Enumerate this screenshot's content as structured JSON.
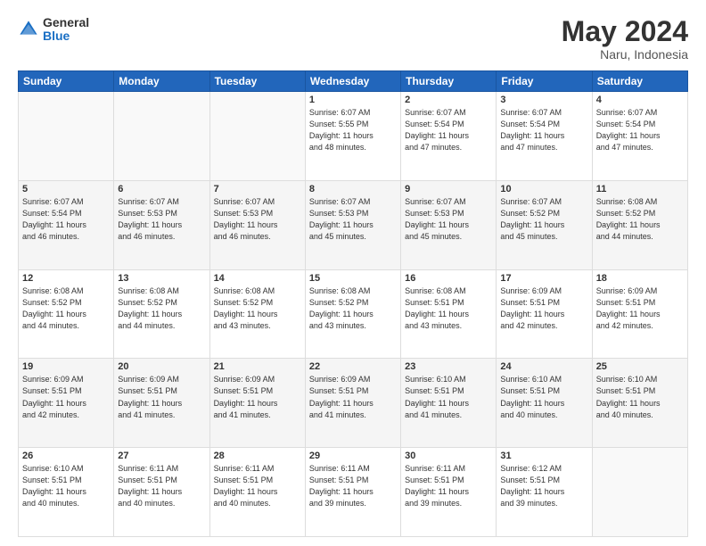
{
  "logo": {
    "general": "General",
    "blue": "Blue"
  },
  "title": "May 2024",
  "subtitle": "Naru, Indonesia",
  "days_header": [
    "Sunday",
    "Monday",
    "Tuesday",
    "Wednesday",
    "Thursday",
    "Friday",
    "Saturday"
  ],
  "weeks": [
    [
      {
        "num": "",
        "info": ""
      },
      {
        "num": "",
        "info": ""
      },
      {
        "num": "",
        "info": ""
      },
      {
        "num": "1",
        "info": "Sunrise: 6:07 AM\nSunset: 5:55 PM\nDaylight: 11 hours\nand 48 minutes."
      },
      {
        "num": "2",
        "info": "Sunrise: 6:07 AM\nSunset: 5:54 PM\nDaylight: 11 hours\nand 47 minutes."
      },
      {
        "num": "3",
        "info": "Sunrise: 6:07 AM\nSunset: 5:54 PM\nDaylight: 11 hours\nand 47 minutes."
      },
      {
        "num": "4",
        "info": "Sunrise: 6:07 AM\nSunset: 5:54 PM\nDaylight: 11 hours\nand 47 minutes."
      }
    ],
    [
      {
        "num": "5",
        "info": "Sunrise: 6:07 AM\nSunset: 5:54 PM\nDaylight: 11 hours\nand 46 minutes."
      },
      {
        "num": "6",
        "info": "Sunrise: 6:07 AM\nSunset: 5:53 PM\nDaylight: 11 hours\nand 46 minutes."
      },
      {
        "num": "7",
        "info": "Sunrise: 6:07 AM\nSunset: 5:53 PM\nDaylight: 11 hours\nand 46 minutes."
      },
      {
        "num": "8",
        "info": "Sunrise: 6:07 AM\nSunset: 5:53 PM\nDaylight: 11 hours\nand 45 minutes."
      },
      {
        "num": "9",
        "info": "Sunrise: 6:07 AM\nSunset: 5:53 PM\nDaylight: 11 hours\nand 45 minutes."
      },
      {
        "num": "10",
        "info": "Sunrise: 6:07 AM\nSunset: 5:52 PM\nDaylight: 11 hours\nand 45 minutes."
      },
      {
        "num": "11",
        "info": "Sunrise: 6:08 AM\nSunset: 5:52 PM\nDaylight: 11 hours\nand 44 minutes."
      }
    ],
    [
      {
        "num": "12",
        "info": "Sunrise: 6:08 AM\nSunset: 5:52 PM\nDaylight: 11 hours\nand 44 minutes."
      },
      {
        "num": "13",
        "info": "Sunrise: 6:08 AM\nSunset: 5:52 PM\nDaylight: 11 hours\nand 44 minutes."
      },
      {
        "num": "14",
        "info": "Sunrise: 6:08 AM\nSunset: 5:52 PM\nDaylight: 11 hours\nand 43 minutes."
      },
      {
        "num": "15",
        "info": "Sunrise: 6:08 AM\nSunset: 5:52 PM\nDaylight: 11 hours\nand 43 minutes."
      },
      {
        "num": "16",
        "info": "Sunrise: 6:08 AM\nSunset: 5:51 PM\nDaylight: 11 hours\nand 43 minutes."
      },
      {
        "num": "17",
        "info": "Sunrise: 6:09 AM\nSunset: 5:51 PM\nDaylight: 11 hours\nand 42 minutes."
      },
      {
        "num": "18",
        "info": "Sunrise: 6:09 AM\nSunset: 5:51 PM\nDaylight: 11 hours\nand 42 minutes."
      }
    ],
    [
      {
        "num": "19",
        "info": "Sunrise: 6:09 AM\nSunset: 5:51 PM\nDaylight: 11 hours\nand 42 minutes."
      },
      {
        "num": "20",
        "info": "Sunrise: 6:09 AM\nSunset: 5:51 PM\nDaylight: 11 hours\nand 41 minutes."
      },
      {
        "num": "21",
        "info": "Sunrise: 6:09 AM\nSunset: 5:51 PM\nDaylight: 11 hours\nand 41 minutes."
      },
      {
        "num": "22",
        "info": "Sunrise: 6:09 AM\nSunset: 5:51 PM\nDaylight: 11 hours\nand 41 minutes."
      },
      {
        "num": "23",
        "info": "Sunrise: 6:10 AM\nSunset: 5:51 PM\nDaylight: 11 hours\nand 41 minutes."
      },
      {
        "num": "24",
        "info": "Sunrise: 6:10 AM\nSunset: 5:51 PM\nDaylight: 11 hours\nand 40 minutes."
      },
      {
        "num": "25",
        "info": "Sunrise: 6:10 AM\nSunset: 5:51 PM\nDaylight: 11 hours\nand 40 minutes."
      }
    ],
    [
      {
        "num": "26",
        "info": "Sunrise: 6:10 AM\nSunset: 5:51 PM\nDaylight: 11 hours\nand 40 minutes."
      },
      {
        "num": "27",
        "info": "Sunrise: 6:11 AM\nSunset: 5:51 PM\nDaylight: 11 hours\nand 40 minutes."
      },
      {
        "num": "28",
        "info": "Sunrise: 6:11 AM\nSunset: 5:51 PM\nDaylight: 11 hours\nand 40 minutes."
      },
      {
        "num": "29",
        "info": "Sunrise: 6:11 AM\nSunset: 5:51 PM\nDaylight: 11 hours\nand 39 minutes."
      },
      {
        "num": "30",
        "info": "Sunrise: 6:11 AM\nSunset: 5:51 PM\nDaylight: 11 hours\nand 39 minutes."
      },
      {
        "num": "31",
        "info": "Sunrise: 6:12 AM\nSunset: 5:51 PM\nDaylight: 11 hours\nand 39 minutes."
      },
      {
        "num": "",
        "info": ""
      }
    ]
  ]
}
